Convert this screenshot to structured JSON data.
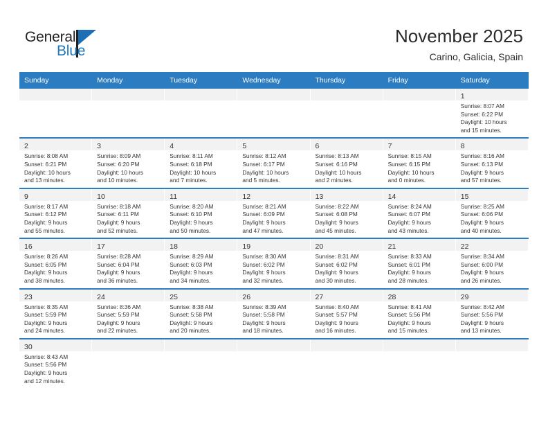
{
  "brand": {
    "name_top": "General",
    "name_bottom": "Blue",
    "logo_icon": "triangle-flag-icon",
    "color_primary": "#1d6fb5",
    "color_dark": "#231f20"
  },
  "header": {
    "title": "November 2025",
    "subtitle": "Carino, Galicia, Spain"
  },
  "calendar": {
    "header_bg": "#2b7cc0",
    "daynum_bg": "#f2f2f2",
    "weekdays": [
      "Sunday",
      "Monday",
      "Tuesday",
      "Wednesday",
      "Thursday",
      "Friday",
      "Saturday"
    ],
    "weeks": [
      [
        {
          "empty": true
        },
        {
          "empty": true
        },
        {
          "empty": true
        },
        {
          "empty": true
        },
        {
          "empty": true
        },
        {
          "empty": true
        },
        {
          "day": "1",
          "sunrise": "Sunrise: 8:07 AM",
          "sunset": "Sunset: 6:22 PM",
          "daylight1": "Daylight: 10 hours",
          "daylight2": "and 15 minutes."
        }
      ],
      [
        {
          "day": "2",
          "sunrise": "Sunrise: 8:08 AM",
          "sunset": "Sunset: 6:21 PM",
          "daylight1": "Daylight: 10 hours",
          "daylight2": "and 13 minutes."
        },
        {
          "day": "3",
          "sunrise": "Sunrise: 8:09 AM",
          "sunset": "Sunset: 6:20 PM",
          "daylight1": "Daylight: 10 hours",
          "daylight2": "and 10 minutes."
        },
        {
          "day": "4",
          "sunrise": "Sunrise: 8:11 AM",
          "sunset": "Sunset: 6:18 PM",
          "daylight1": "Daylight: 10 hours",
          "daylight2": "and 7 minutes."
        },
        {
          "day": "5",
          "sunrise": "Sunrise: 8:12 AM",
          "sunset": "Sunset: 6:17 PM",
          "daylight1": "Daylight: 10 hours",
          "daylight2": "and 5 minutes."
        },
        {
          "day": "6",
          "sunrise": "Sunrise: 8:13 AM",
          "sunset": "Sunset: 6:16 PM",
          "daylight1": "Daylight: 10 hours",
          "daylight2": "and 2 minutes."
        },
        {
          "day": "7",
          "sunrise": "Sunrise: 8:15 AM",
          "sunset": "Sunset: 6:15 PM",
          "daylight1": "Daylight: 10 hours",
          "daylight2": "and 0 minutes."
        },
        {
          "day": "8",
          "sunrise": "Sunrise: 8:16 AM",
          "sunset": "Sunset: 6:13 PM",
          "daylight1": "Daylight: 9 hours",
          "daylight2": "and 57 minutes."
        }
      ],
      [
        {
          "day": "9",
          "sunrise": "Sunrise: 8:17 AM",
          "sunset": "Sunset: 6:12 PM",
          "daylight1": "Daylight: 9 hours",
          "daylight2": "and 55 minutes."
        },
        {
          "day": "10",
          "sunrise": "Sunrise: 8:18 AM",
          "sunset": "Sunset: 6:11 PM",
          "daylight1": "Daylight: 9 hours",
          "daylight2": "and 52 minutes."
        },
        {
          "day": "11",
          "sunrise": "Sunrise: 8:20 AM",
          "sunset": "Sunset: 6:10 PM",
          "daylight1": "Daylight: 9 hours",
          "daylight2": "and 50 minutes."
        },
        {
          "day": "12",
          "sunrise": "Sunrise: 8:21 AM",
          "sunset": "Sunset: 6:09 PM",
          "daylight1": "Daylight: 9 hours",
          "daylight2": "and 47 minutes."
        },
        {
          "day": "13",
          "sunrise": "Sunrise: 8:22 AM",
          "sunset": "Sunset: 6:08 PM",
          "daylight1": "Daylight: 9 hours",
          "daylight2": "and 45 minutes."
        },
        {
          "day": "14",
          "sunrise": "Sunrise: 8:24 AM",
          "sunset": "Sunset: 6:07 PM",
          "daylight1": "Daylight: 9 hours",
          "daylight2": "and 43 minutes."
        },
        {
          "day": "15",
          "sunrise": "Sunrise: 8:25 AM",
          "sunset": "Sunset: 6:06 PM",
          "daylight1": "Daylight: 9 hours",
          "daylight2": "and 40 minutes."
        }
      ],
      [
        {
          "day": "16",
          "sunrise": "Sunrise: 8:26 AM",
          "sunset": "Sunset: 6:05 PM",
          "daylight1": "Daylight: 9 hours",
          "daylight2": "and 38 minutes."
        },
        {
          "day": "17",
          "sunrise": "Sunrise: 8:28 AM",
          "sunset": "Sunset: 6:04 PM",
          "daylight1": "Daylight: 9 hours",
          "daylight2": "and 36 minutes."
        },
        {
          "day": "18",
          "sunrise": "Sunrise: 8:29 AM",
          "sunset": "Sunset: 6:03 PM",
          "daylight1": "Daylight: 9 hours",
          "daylight2": "and 34 minutes."
        },
        {
          "day": "19",
          "sunrise": "Sunrise: 8:30 AM",
          "sunset": "Sunset: 6:02 PM",
          "daylight1": "Daylight: 9 hours",
          "daylight2": "and 32 minutes."
        },
        {
          "day": "20",
          "sunrise": "Sunrise: 8:31 AM",
          "sunset": "Sunset: 6:02 PM",
          "daylight1": "Daylight: 9 hours",
          "daylight2": "and 30 minutes."
        },
        {
          "day": "21",
          "sunrise": "Sunrise: 8:33 AM",
          "sunset": "Sunset: 6:01 PM",
          "daylight1": "Daylight: 9 hours",
          "daylight2": "and 28 minutes."
        },
        {
          "day": "22",
          "sunrise": "Sunrise: 8:34 AM",
          "sunset": "Sunset: 6:00 PM",
          "daylight1": "Daylight: 9 hours",
          "daylight2": "and 26 minutes."
        }
      ],
      [
        {
          "day": "23",
          "sunrise": "Sunrise: 8:35 AM",
          "sunset": "Sunset: 5:59 PM",
          "daylight1": "Daylight: 9 hours",
          "daylight2": "and 24 minutes."
        },
        {
          "day": "24",
          "sunrise": "Sunrise: 8:36 AM",
          "sunset": "Sunset: 5:59 PM",
          "daylight1": "Daylight: 9 hours",
          "daylight2": "and 22 minutes."
        },
        {
          "day": "25",
          "sunrise": "Sunrise: 8:38 AM",
          "sunset": "Sunset: 5:58 PM",
          "daylight1": "Daylight: 9 hours",
          "daylight2": "and 20 minutes."
        },
        {
          "day": "26",
          "sunrise": "Sunrise: 8:39 AM",
          "sunset": "Sunset: 5:58 PM",
          "daylight1": "Daylight: 9 hours",
          "daylight2": "and 18 minutes."
        },
        {
          "day": "27",
          "sunrise": "Sunrise: 8:40 AM",
          "sunset": "Sunset: 5:57 PM",
          "daylight1": "Daylight: 9 hours",
          "daylight2": "and 16 minutes."
        },
        {
          "day": "28",
          "sunrise": "Sunrise: 8:41 AM",
          "sunset": "Sunset: 5:56 PM",
          "daylight1": "Daylight: 9 hours",
          "daylight2": "and 15 minutes."
        },
        {
          "day": "29",
          "sunrise": "Sunrise: 8:42 AM",
          "sunset": "Sunset: 5:56 PM",
          "daylight1": "Daylight: 9 hours",
          "daylight2": "and 13 minutes."
        }
      ],
      [
        {
          "day": "30",
          "sunrise": "Sunrise: 8:43 AM",
          "sunset": "Sunset: 5:56 PM",
          "daylight1": "Daylight: 9 hours",
          "daylight2": "and 12 minutes."
        },
        {
          "empty": true
        },
        {
          "empty": true
        },
        {
          "empty": true
        },
        {
          "empty": true
        },
        {
          "empty": true
        },
        {
          "empty": true
        }
      ]
    ]
  }
}
